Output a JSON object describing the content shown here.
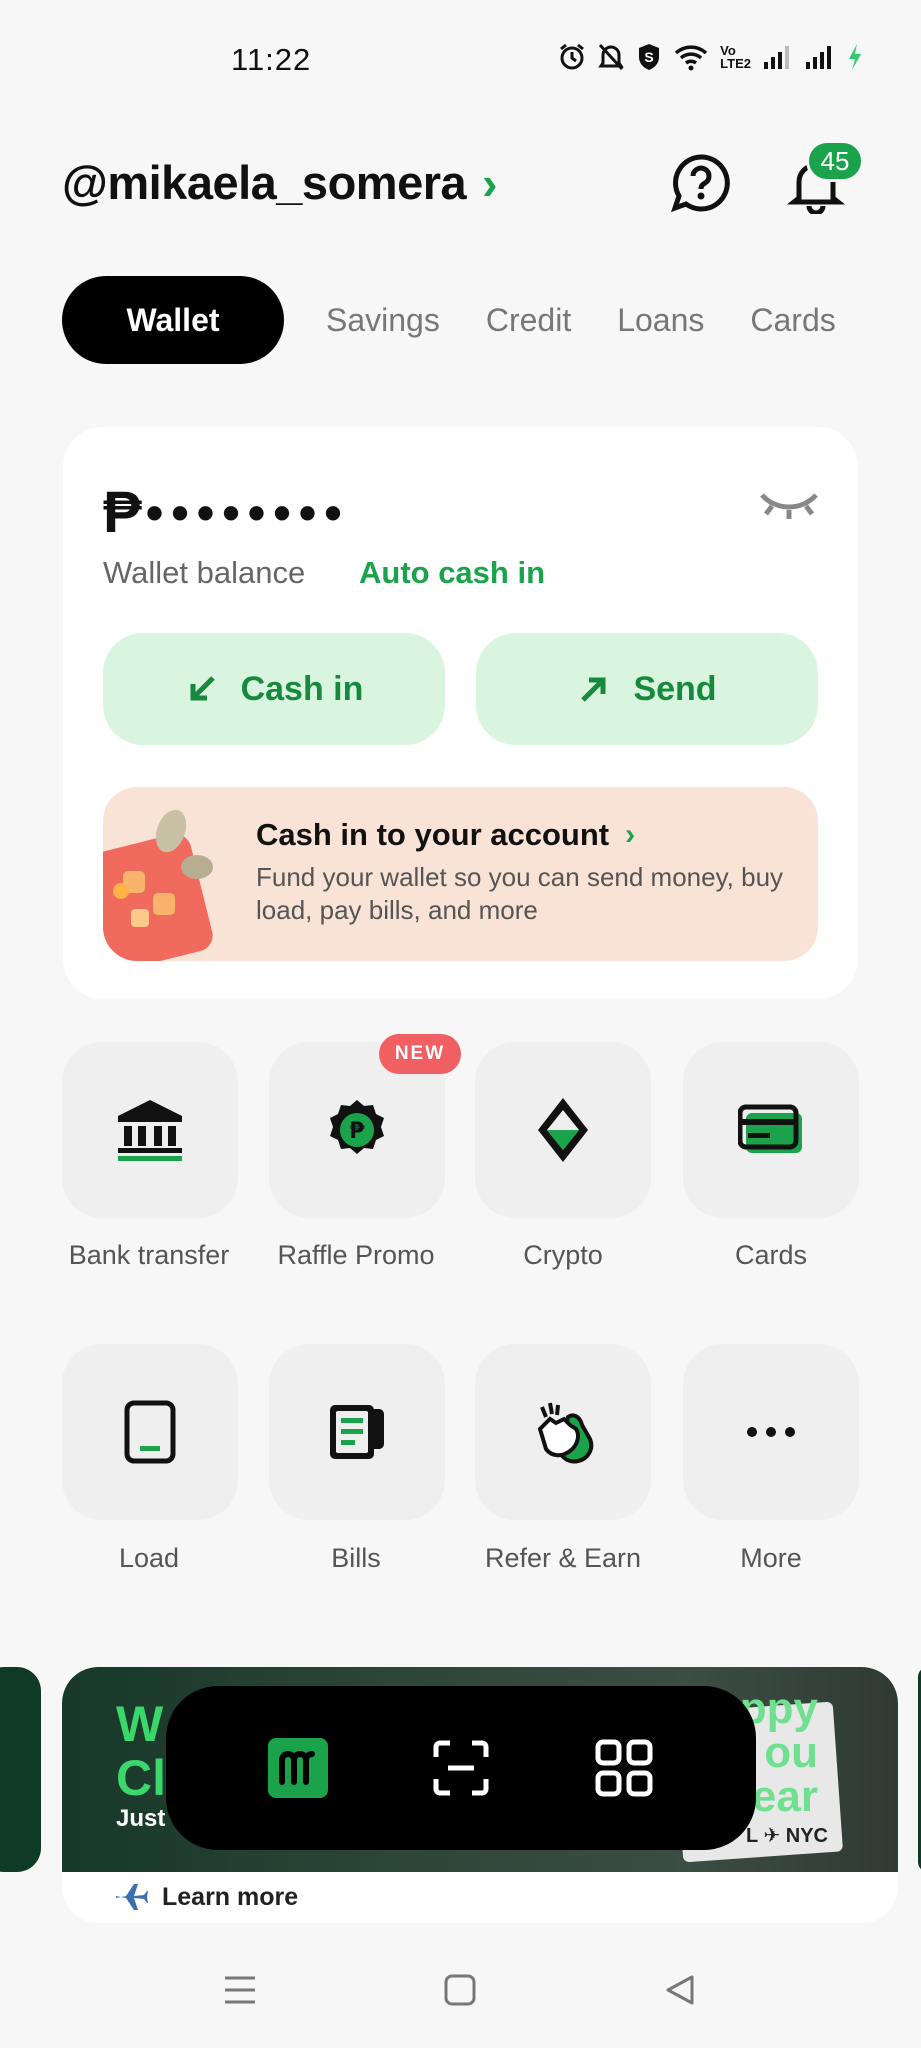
{
  "status_bar": {
    "time": "11:22",
    "vo_label": "Vo",
    "lte_label": "LTE2"
  },
  "header": {
    "username": "@mikaela_somera",
    "notification_count": "45"
  },
  "tabs": [
    {
      "label": "Wallet",
      "active": true
    },
    {
      "label": "Savings",
      "active": false
    },
    {
      "label": "Credit",
      "active": false
    },
    {
      "label": "Loans",
      "active": false
    },
    {
      "label": "Cards",
      "active": false
    }
  ],
  "wallet": {
    "currency_symbol": "₱",
    "masked_balance": "••••••••",
    "balance_label": "Wallet balance",
    "auto_cash_in_label": "Auto cash in",
    "cash_in_label": "Cash in",
    "send_label": "Send",
    "promo": {
      "title": "Cash in to your account",
      "description": "Fund your wallet so you can send money, buy load, pay bills, and more"
    }
  },
  "services_row1": [
    {
      "label": "Bank transfer",
      "icon": "bank-icon"
    },
    {
      "label": "Raffle Promo",
      "icon": "raffle-icon",
      "badge": "NEW"
    },
    {
      "label": "Crypto",
      "icon": "crypto-icon"
    },
    {
      "label": "Cards",
      "icon": "card-icon"
    }
  ],
  "services_row2": [
    {
      "label": "Load",
      "icon": "phone-icon"
    },
    {
      "label": "Bills",
      "icon": "bill-icon"
    },
    {
      "label": "Refer & Earn",
      "icon": "high-five-icon"
    },
    {
      "label": "More",
      "icon": "more-icon"
    }
  ],
  "banner": {
    "headline_partial": "W\nCl",
    "subtext_partial": "Just",
    "right_text_partial": "ppy\nou\near",
    "route_text": "L ✈ NYC",
    "learn_more_label": "Learn more"
  },
  "colors": {
    "accent_green": "#1aa34a",
    "light_green": "#d9f4df",
    "promo_peach": "#f9e3d6",
    "badge_red": "#f06062"
  }
}
